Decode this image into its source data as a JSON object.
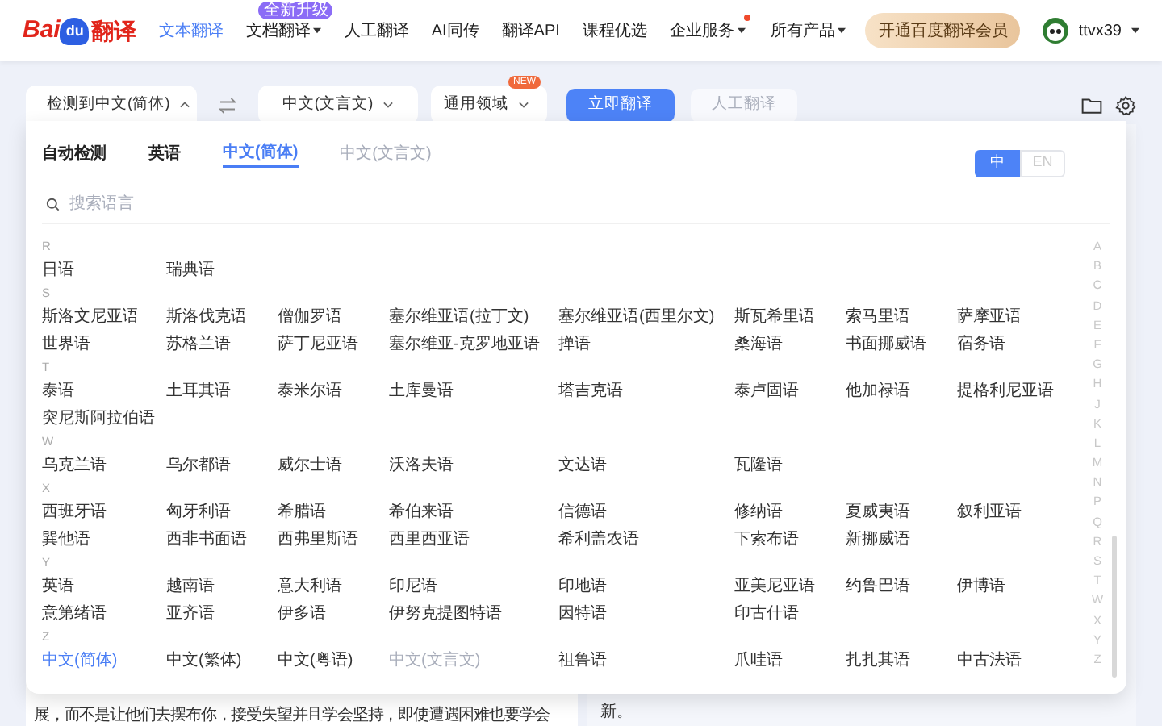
{
  "header": {
    "logo": {
      "left": "Bai",
      "paw": "du",
      "right": "翻译"
    },
    "nav": [
      {
        "label": "文本翻译",
        "selected": true,
        "caret": false
      },
      {
        "label": "文档翻译",
        "selected": false,
        "caret": true,
        "badge": "全新升级"
      },
      {
        "label": "人工翻译",
        "selected": false,
        "caret": false
      },
      {
        "label": "AI同传",
        "selected": false,
        "caret": false
      },
      {
        "label": "翻译API",
        "selected": false,
        "caret": false
      },
      {
        "label": "课程优选",
        "selected": false,
        "caret": false
      },
      {
        "label": "企业服务",
        "selected": false,
        "caret": true,
        "dot": true
      }
    ],
    "products": "所有产品",
    "vip_button": "开通百度翻译会员",
    "username": "ttvx39"
  },
  "toolbar": {
    "source": "检测到中文(简体)",
    "source_expanded": true,
    "target": "中文(文言文)",
    "domain": "通用领域",
    "domain_badge": "NEW",
    "translate_button": "立即翻译",
    "human_button": "人工翻译",
    "human_disabled": true
  },
  "language_panel": {
    "tabs": [
      {
        "label": "自动检测",
        "selected": false,
        "disabled": false
      },
      {
        "label": "英语",
        "selected": false,
        "disabled": false
      },
      {
        "label": "中文(简体)",
        "selected": true,
        "disabled": false
      },
      {
        "label": "中文(文言文)",
        "selected": false,
        "disabled": true
      }
    ],
    "ui_language": [
      {
        "label": "中",
        "selected": true
      },
      {
        "label": "EN",
        "selected": false
      }
    ],
    "search": {
      "placeholder": "搜索语言"
    },
    "groups": [
      {
        "letter": "R",
        "items": [
          {
            "label": "日语"
          },
          {
            "label": "瑞典语"
          }
        ]
      },
      {
        "letter": "S",
        "items": [
          {
            "label": "斯洛文尼亚语"
          },
          {
            "label": "斯洛伐克语"
          },
          {
            "label": "僧伽罗语"
          },
          {
            "label": "塞尔维亚语(拉丁文)"
          },
          {
            "label": "塞尔维亚语(西里尔文)"
          },
          {
            "label": "斯瓦希里语"
          },
          {
            "label": "索马里语"
          },
          {
            "label": "萨摩亚语"
          },
          {
            "label": "世界语"
          },
          {
            "label": "苏格兰语"
          },
          {
            "label": "萨丁尼亚语"
          },
          {
            "label": "塞尔维亚-克罗地亚语"
          },
          {
            "label": "掸语"
          },
          {
            "label": "桑海语"
          },
          {
            "label": "书面挪威语"
          },
          {
            "label": "宿务语"
          }
        ]
      },
      {
        "letter": "T",
        "items": [
          {
            "label": "泰语"
          },
          {
            "label": "土耳其语"
          },
          {
            "label": "泰米尔语"
          },
          {
            "label": "土库曼语"
          },
          {
            "label": "塔吉克语"
          },
          {
            "label": "泰卢固语"
          },
          {
            "label": "他加禄语"
          },
          {
            "label": "提格利尼亚语"
          },
          {
            "label": "突尼斯阿拉伯语"
          }
        ]
      },
      {
        "letter": "W",
        "items": [
          {
            "label": "乌克兰语"
          },
          {
            "label": "乌尔都语"
          },
          {
            "label": "威尔士语"
          },
          {
            "label": "沃洛夫语"
          },
          {
            "label": "文达语"
          },
          {
            "label": "瓦隆语"
          }
        ]
      },
      {
        "letter": "X",
        "items": [
          {
            "label": "西班牙语"
          },
          {
            "label": "匈牙利语"
          },
          {
            "label": "希腊语"
          },
          {
            "label": "希伯来语"
          },
          {
            "label": "信德语"
          },
          {
            "label": "修纳语"
          },
          {
            "label": "夏威夷语"
          },
          {
            "label": "叙利亚语"
          },
          {
            "label": "巽他语"
          },
          {
            "label": "西非书面语"
          },
          {
            "label": "西弗里斯语"
          },
          {
            "label": "西里西亚语"
          },
          {
            "label": "希利盖农语"
          },
          {
            "label": "下索布语"
          },
          {
            "label": "新挪威语"
          }
        ]
      },
      {
        "letter": "Y",
        "items": [
          {
            "label": "英语"
          },
          {
            "label": "越南语"
          },
          {
            "label": "意大利语"
          },
          {
            "label": "印尼语"
          },
          {
            "label": "印地语"
          },
          {
            "label": "亚美尼亚语"
          },
          {
            "label": "约鲁巴语"
          },
          {
            "label": "伊博语"
          },
          {
            "label": "意第绪语"
          },
          {
            "label": "亚齐语"
          },
          {
            "label": "伊多语"
          },
          {
            "label": "伊努克提图特语"
          },
          {
            "label": "因特语"
          },
          {
            "label": "印古什语"
          }
        ]
      },
      {
        "letter": "Z",
        "items": [
          {
            "label": "中文(简体)",
            "selected": true
          },
          {
            "label": "中文(繁体)"
          },
          {
            "label": "中文(粤语)"
          },
          {
            "label": "中文(文言文)",
            "disabled": true
          },
          {
            "label": "祖鲁语"
          },
          {
            "label": "爪哇语"
          },
          {
            "label": "扎扎其语"
          },
          {
            "label": "中古法语"
          }
        ]
      }
    ],
    "index": [
      "A",
      "B",
      "C",
      "D",
      "E",
      "F",
      "G",
      "H",
      "J",
      "K",
      "L",
      "M",
      "N",
      "P",
      "Q",
      "R",
      "S",
      "T",
      "W",
      "X",
      "Y",
      "Z"
    ]
  },
  "source_text": "展，而不是让他们去摆布你，接受失望并且学会坚持，即使遭遇困难也要学会",
  "target_text": "新。"
}
